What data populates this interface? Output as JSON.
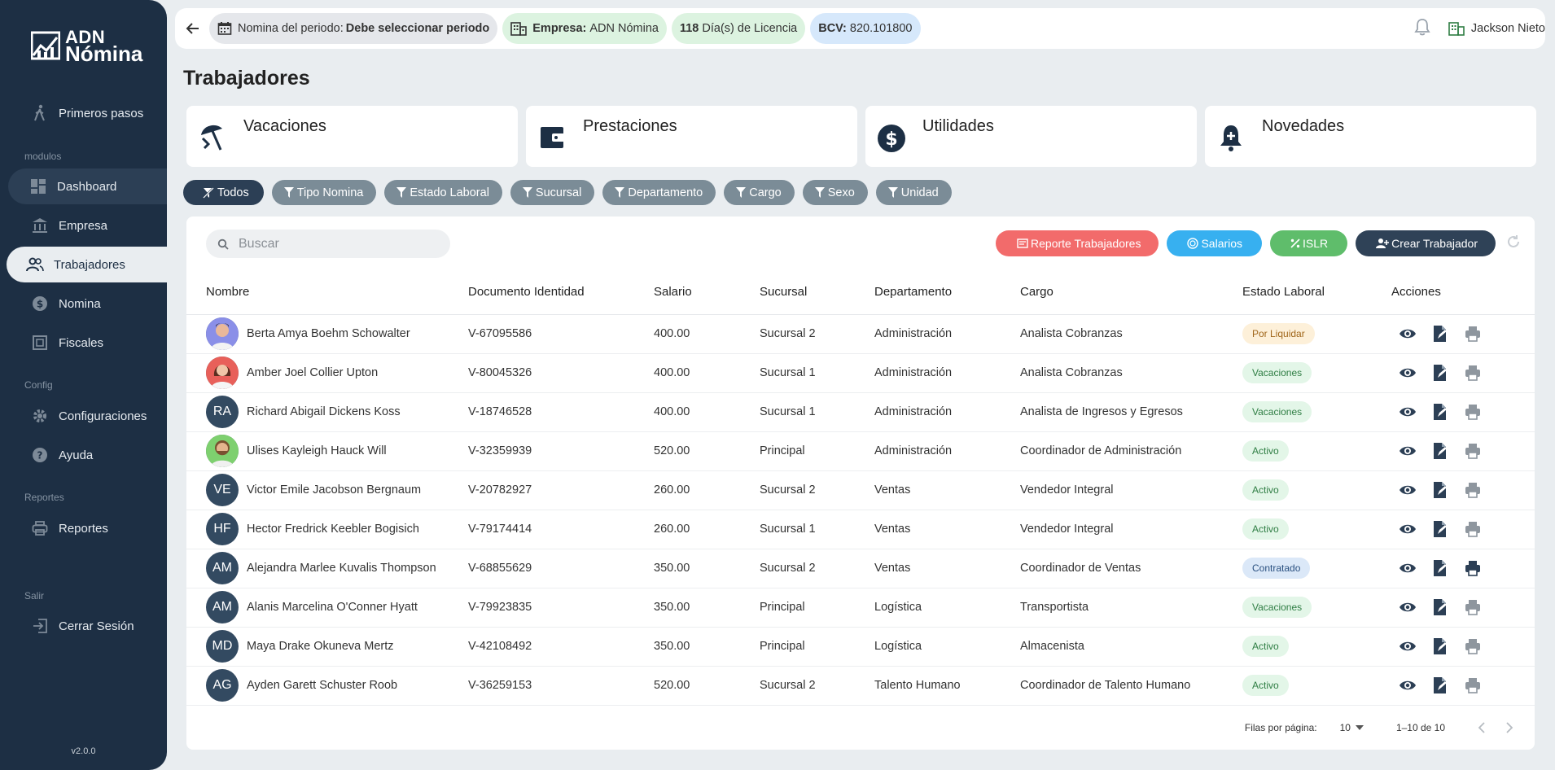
{
  "brand": {
    "line1": "ADN",
    "line2": "Nómina"
  },
  "sidebar": {
    "getting_started": "Primeros pasos",
    "sections": {
      "modules": "modulos",
      "config": "Config",
      "reports": "Reportes",
      "exit": "Salir"
    },
    "items": {
      "dashboard": "Dashboard",
      "company": "Empresa",
      "workers": "Trabajadores",
      "payroll": "Nomina",
      "fiscal": "Fiscales",
      "settings": "Configuraciones",
      "help": "Ayuda",
      "reports": "Reportes",
      "logout": "Cerrar Sesión"
    },
    "version": "v2.0.0"
  },
  "topbar": {
    "period_label": "Nomina del periodo:",
    "period_value": "Debe seleccionar periodo",
    "company_label": "Empresa:",
    "company_value": "ADN Nómina",
    "license_count": "118",
    "license_text": "Día(s) de Licencia",
    "bcv_label": "BCV:",
    "bcv_value": "820.101800",
    "user_name": "Jackson Nieto"
  },
  "page_title": "Trabajadores",
  "cards": {
    "vacations": "Vacaciones",
    "benefits": "Prestaciones",
    "profits": "Utilidades",
    "news": "Novedades"
  },
  "filters": {
    "all": "Todos",
    "payroll_type": "Tipo Nomina",
    "labor_status": "Estado Laboral",
    "branch": "Sucursal",
    "department": "Departamento",
    "position": "Cargo",
    "sex": "Sexo",
    "unit": "Unidad"
  },
  "search": {
    "placeholder": "Buscar"
  },
  "actions": {
    "workers_report": "Reporte Trabajadores",
    "salaries": "Salarios",
    "islr": "ISLR",
    "create_worker": "Crear Trabajador"
  },
  "table": {
    "headers": {
      "name": "Nombre",
      "id_doc": "Documento Identidad",
      "salary": "Salario",
      "branch": "Sucursal",
      "department": "Departamento",
      "position": "Cargo",
      "status": "Estado Laboral",
      "actions": "Acciones"
    },
    "rows": [
      {
        "initials": "",
        "photo": "man-1",
        "name": "Berta Amya Boehm Schowalter",
        "id": "V-67095586",
        "salary": "400.00",
        "branch": "Sucursal 2",
        "dept": "Administración",
        "position": "Analista Cobranzas",
        "status": "Por Liquidar",
        "status_kind": "orange"
      },
      {
        "initials": "",
        "photo": "woman-1",
        "name": "Amber Joel Collier Upton",
        "id": "V-80045326",
        "salary": "400.00",
        "branch": "Sucursal 1",
        "dept": "Administración",
        "position": "Analista Cobranzas",
        "status": "Vacaciones",
        "status_kind": "green"
      },
      {
        "initials": "RA",
        "photo": "",
        "name": "Richard Abigail Dickens Koss",
        "id": "V-18746528",
        "salary": "400.00",
        "branch": "Sucursal 1",
        "dept": "Administración",
        "position": "Analista de Ingresos y Egresos",
        "status": "Vacaciones",
        "status_kind": "green"
      },
      {
        "initials": "",
        "photo": "man-2",
        "name": "Ulises Kayleigh Hauck Will",
        "id": "V-32359939",
        "salary": "520.00",
        "branch": "Principal",
        "dept": "Administración",
        "position": "Coordinador de Administración",
        "status": "Activo",
        "status_kind": "green"
      },
      {
        "initials": "VE",
        "photo": "",
        "name": "Victor Emile Jacobson Bergnaum",
        "id": "V-20782927",
        "salary": "260.00",
        "branch": "Sucursal 2",
        "dept": "Ventas",
        "position": "Vendedor Integral",
        "status": "Activo",
        "status_kind": "green"
      },
      {
        "initials": "HF",
        "photo": "",
        "name": "Hector Fredrick Keebler Bogisich",
        "id": "V-79174414",
        "salary": "260.00",
        "branch": "Sucursal 1",
        "dept": "Ventas",
        "position": "Vendedor Integral",
        "status": "Activo",
        "status_kind": "green"
      },
      {
        "initials": "AM",
        "photo": "",
        "name": "Alejandra Marlee Kuvalis Thompson",
        "id": "V-68855629",
        "salary": "350.00",
        "branch": "Sucursal 2",
        "dept": "Ventas",
        "position": "Coordinador de Ventas",
        "status": "Contratado",
        "status_kind": "blue"
      },
      {
        "initials": "AM",
        "photo": "",
        "name": "Alanis Marcelina O'Conner Hyatt",
        "id": "V-79923835",
        "salary": "350.00",
        "branch": "Principal",
        "dept": "Logística",
        "position": "Transportista",
        "status": "Vacaciones",
        "status_kind": "green"
      },
      {
        "initials": "MD",
        "photo": "",
        "name": "Maya Drake Okuneva Mertz",
        "id": "V-42108492",
        "salary": "350.00",
        "branch": "Principal",
        "dept": "Logística",
        "position": "Almacenista",
        "status": "Activo",
        "status_kind": "green"
      },
      {
        "initials": "AG",
        "photo": "",
        "name": "Ayden Garett Schuster Roob",
        "id": "V-36259153",
        "salary": "520.00",
        "branch": "Sucursal 2",
        "dept": "Talento Humano",
        "position": "Coordinador de Talento Humano",
        "status": "Activo",
        "status_kind": "green"
      }
    ]
  },
  "pagination": {
    "rows_per_page_label": "Filas por página:",
    "rows_per_page": "10",
    "range": "1–10 de 10"
  },
  "colors": {
    "sidebar_bg": "#1d2f44",
    "accent_dark": "#2c3f55",
    "filter_bg": "#7b8c97",
    "btn_red": "#f26b6b",
    "btn_blue": "#37b0f0",
    "btn_green": "#5fbd6b",
    "status_green_bg": "#e3f6e8",
    "status_green_fg": "#2e7d43",
    "status_orange_bg": "#fdf0d9",
    "status_orange_fg": "#a0661a",
    "status_blue_bg": "#dbe8f8",
    "status_blue_fg": "#2a5080"
  }
}
